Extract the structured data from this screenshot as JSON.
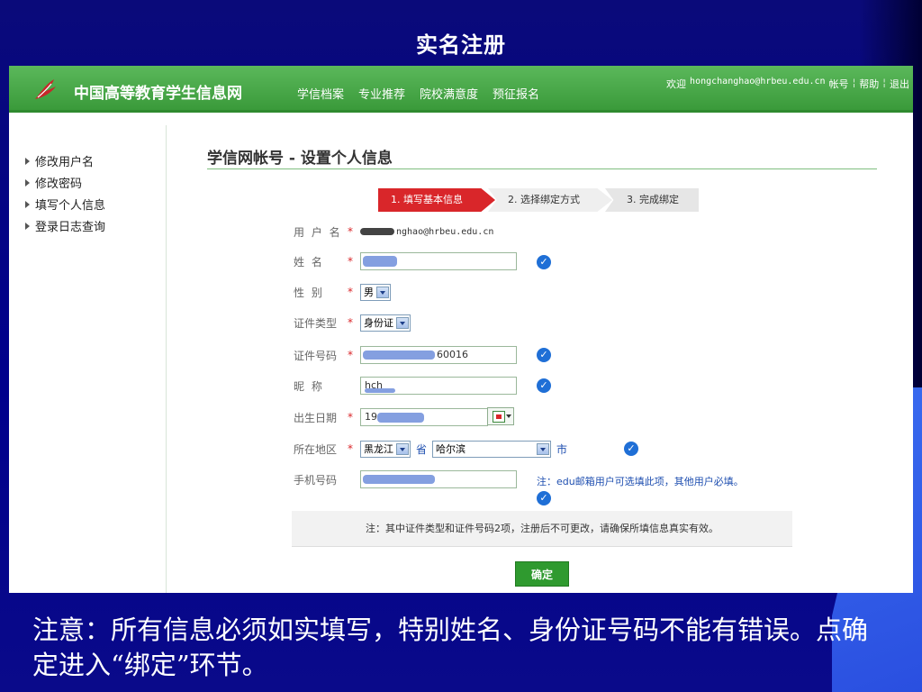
{
  "slide": {
    "title": "实名注册",
    "caption": "注意：所有信息必须如实填写，特别姓名、身份证号码不能有错误。点确定进入“绑定”环节。"
  },
  "header": {
    "site_name": "中国高等教育学生信息网",
    "nav": [
      "学信档案",
      "专业推荐",
      "院校满意度",
      "预征报名"
    ],
    "welcome": "欢迎",
    "user_email": "hongchanghao@hrbeu.edu.cn",
    "links": [
      "帐号",
      "帮助",
      "退出"
    ]
  },
  "sidebar": {
    "items": [
      "修改用户名",
      "修改密码",
      "填写个人信息",
      "登录日志查询"
    ]
  },
  "main": {
    "section_title": "学信网帐号 - 设置个人信息",
    "steps": [
      "1. 填写基本信息",
      "2. 选择绑定方式",
      "3. 完成绑定"
    ],
    "form": {
      "username_label": "用 户 名",
      "username_value": "nghao@hrbeu.edu.cn",
      "name_label": "姓    名",
      "name_value": "",
      "gender_label": "性    别",
      "gender_value": "男",
      "idtype_label": "证件类型",
      "idtype_value": "身份证",
      "idnum_label": "证件号码",
      "idnum_value": "60016",
      "nickname_label": "昵    称",
      "nickname_value": "hch",
      "birth_label": "出生日期",
      "birth_value": "19",
      "region_label": "所在地区",
      "province_value": "黑龙江",
      "province_suffix": "省",
      "city_value": "哈尔滨",
      "city_suffix": "市",
      "phone_label": "手机号码",
      "phone_value": "",
      "phone_note": "注：edu邮箱用户可选填此项，其他用户必填。",
      "required_mark": "*"
    },
    "notice": "注：其中证件类型和证件号码2项，注册后不可更改，请确保所填信息真实有效。",
    "confirm_label": "确定"
  },
  "colors": {
    "slide_bg": "#00008c",
    "header_green": "#3a9a3a",
    "step_active": "#d9262a",
    "check_blue": "#1f6fd6",
    "confirm_green": "#2f9a2f"
  },
  "icons": {
    "logo": "red-bird-logo-icon",
    "check": "check-circle-icon",
    "calendar": "calendar-icon",
    "dropdown": "chevron-down-icon",
    "bullet": "triangle-right-icon"
  }
}
